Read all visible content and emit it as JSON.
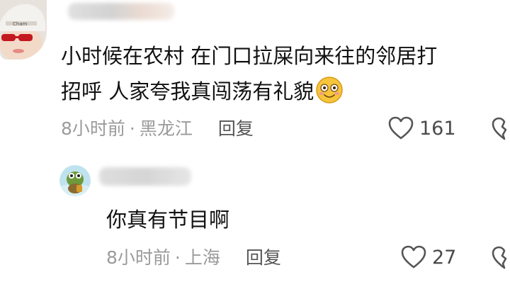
{
  "comments": [
    {
      "text": "小时候在农村  在门口拉屎向来往的邻居打",
      "text_line2": "招呼   人家夸我真闯荡有礼貌",
      "emoji": "smiling-face-emoji",
      "time": "8小时前",
      "location": "黑龙江",
      "reply_label": "回复",
      "likes": "161"
    },
    {
      "text": "你真有节目啊",
      "time": "8小时前",
      "location": "上海",
      "reply_label": "回复",
      "likes": "27"
    }
  ],
  "meta_separator": "·",
  "colors": {
    "meta": "#9b9b9b",
    "reply": "#555555",
    "text": "#111111",
    "emoji_face": "#f6c53c"
  }
}
